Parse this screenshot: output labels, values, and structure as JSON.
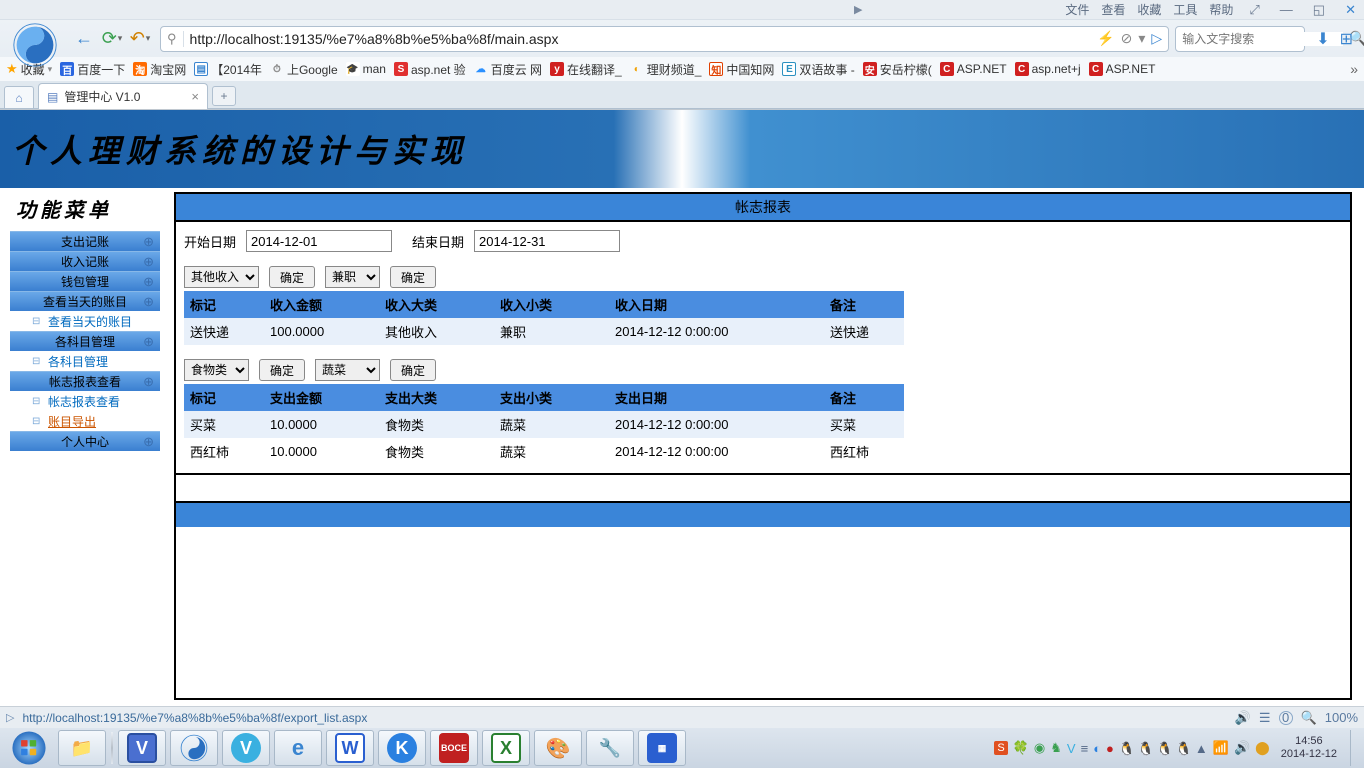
{
  "browser": {
    "menu": [
      "文件",
      "查看",
      "收藏",
      "工具",
      "帮助"
    ],
    "url": "http://localhost:19135/%e7%a8%8b%e5%ba%8f/main.aspx",
    "search_placeholder": "输入文字搜索",
    "tab_title": "管理中心 V1.0",
    "bookmarks_label": "收藏",
    "bookmarks": [
      {
        "label": "百度一下",
        "color": "#2a66e0"
      },
      {
        "label": "淘宝网",
        "color": "#ff6a00"
      },
      {
        "label": "【2014年",
        "color": "#3a85d0"
      },
      {
        "label": "上Google",
        "color": "#888"
      },
      {
        "label": "man",
        "color": "#333"
      },
      {
        "label": "asp.net 验",
        "color": "#e03030"
      },
      {
        "label": "百度云 网",
        "color": "#2a90ff"
      },
      {
        "label": "在线翻译_",
        "color": "#d02020"
      },
      {
        "label": "理财频道_",
        "color": "#f0a000"
      },
      {
        "label": "中国知网",
        "color": "#e04000"
      },
      {
        "label": "双语故事 -",
        "color": "#2a90c0"
      },
      {
        "label": "安岳柠檬(",
        "color": "#d02020"
      },
      {
        "label": "ASP.NET",
        "color": "#d02020"
      },
      {
        "label": "asp.net+j",
        "color": "#d02020"
      },
      {
        "label": "ASP.NET",
        "color": "#d02020"
      }
    ]
  },
  "page": {
    "banner_title": "个人理财系统的设计与实现",
    "sidebar_title": "功能菜单",
    "menu": [
      {
        "type": "main",
        "label": "支出记账"
      },
      {
        "type": "main",
        "label": "收入记账"
      },
      {
        "type": "main",
        "label": "钱包管理"
      },
      {
        "type": "main",
        "label": "查看当天的账目"
      },
      {
        "type": "sub",
        "label": "查看当天的账目"
      },
      {
        "type": "main",
        "label": "各科目管理"
      },
      {
        "type": "sub",
        "label": "各科目管理"
      },
      {
        "type": "main",
        "label": "帐志报表查看"
      },
      {
        "type": "sub",
        "label": "帐志报表查看"
      },
      {
        "type": "sub",
        "label": "账目导出",
        "active": true
      },
      {
        "type": "main",
        "label": "个人中心"
      }
    ],
    "report_title": "帐志报表",
    "start_date_label": "开始日期",
    "start_date": "2014-12-01",
    "end_date_label": "结束日期",
    "end_date": "2014-12-31",
    "income_cat_sel": "其他收入",
    "income_sub_sel": "兼职",
    "expense_cat_sel": "食物类",
    "expense_sub_sel": "蔬菜",
    "confirm_btn": "确定",
    "income_headers": [
      "标记",
      "收入金额",
      "收入大类",
      "收入小类",
      "收入日期",
      "备注"
    ],
    "income_rows": [
      {
        "mark": "送快递",
        "amount": "100.0000",
        "cat": "其他收入",
        "sub": "兼职",
        "date": "2014-12-12 0:00:00",
        "note": "送快递"
      }
    ],
    "expense_headers": [
      "标记",
      "支出金额",
      "支出大类",
      "支出小类",
      "支出日期",
      "备注"
    ],
    "expense_rows": [
      {
        "mark": "买菜",
        "amount": "10.0000",
        "cat": "食物类",
        "sub": "蔬菜",
        "date": "2014-12-12 0:00:00",
        "note": "买菜"
      },
      {
        "mark": "西红柿",
        "amount": "10.0000",
        "cat": "食物类",
        "sub": "蔬菜",
        "date": "2014-12-12 0:00:00",
        "note": "西红柿"
      }
    ]
  },
  "status": {
    "url": "http://localhost:19135/%e7%a8%8b%e5%ba%8f/export_list.aspx",
    "zoom": "100%"
  },
  "taskbar": {
    "time": "14:56",
    "date": "2014-12-12"
  }
}
